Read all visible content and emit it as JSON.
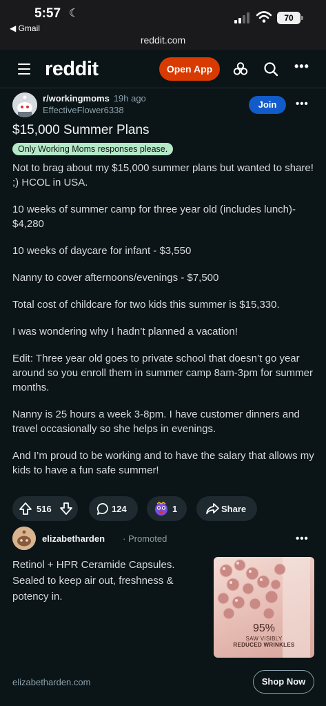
{
  "status_bar": {
    "time": "5:57",
    "back_app": "◀ Gmail",
    "battery": "70"
  },
  "browser": {
    "url": "reddit.com"
  },
  "header": {
    "logo": "reddit",
    "open_app_label": "Open App"
  },
  "post": {
    "subreddit": "r/workingmoms",
    "age": "19h ago",
    "author": "EffectiveFlower6338",
    "join_label": "Join",
    "title": "$15,000 Summer Plans",
    "flair": "Only Working Moms responses please.",
    "paragraphs": [
      "Not to brag about my $15,000 summer plans but wanted to share! ;) HCOL in USA.",
      "10 weeks of summer camp for three year old (includes lunch)- $4,280",
      "10 weeks of daycare for infant - $3,550",
      "Nanny to cover afternoons/evenings - $7,500",
      "Total cost of childcare for two kids this summer is $15,330.",
      "I was wondering why I hadn’t planned a vacation!",
      "Edit: Three year old goes to private school that doesn’t go year around so you enroll them in summer camp 8am-3pm for summer months.",
      "Nanny is 25 hours a week 3-8pm. I have customer dinners and travel occasionally so she helps in evenings.",
      "And I’m proud to be working and to have the salary that allows my kids to have a fun safe summer!"
    ],
    "votes": "516",
    "comments": "124",
    "awards": "1",
    "share_label": "Share"
  },
  "ad": {
    "advertiser": "elizabetharden",
    "promoted": "· Promoted",
    "text": "Retinol + HPR Ceramide Capsules. Sealed to keep air out, freshness & potency in.",
    "image_percent": "95%",
    "image_line1": "SAW VISIBLY",
    "image_line2": "REDUCED WRINKLES",
    "domain": "elizabetharden.com",
    "cta": "Shop Now"
  },
  "colors": {
    "background": "#0b1416",
    "open_app": "#d93a00",
    "join": "#115bca",
    "flair": "#b5e8c7",
    "pill": "#1e2a2f"
  }
}
